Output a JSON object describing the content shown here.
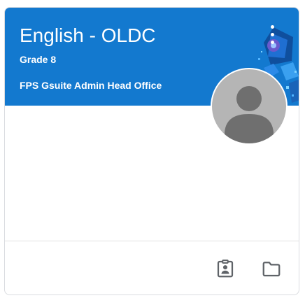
{
  "card": {
    "title": "English - OLDC",
    "section": "Grade 8",
    "owner": "FPS Gsuite Admin Head Office",
    "colors": {
      "header_bg": "#1379cf",
      "avatar_bg": "#b5b5b5",
      "icon": "#5f6368"
    },
    "icons": {
      "menu": "more-vert-icon",
      "avatar": "person-avatar-icon",
      "work": "assignment-ind-icon",
      "folder": "folder-icon"
    }
  }
}
